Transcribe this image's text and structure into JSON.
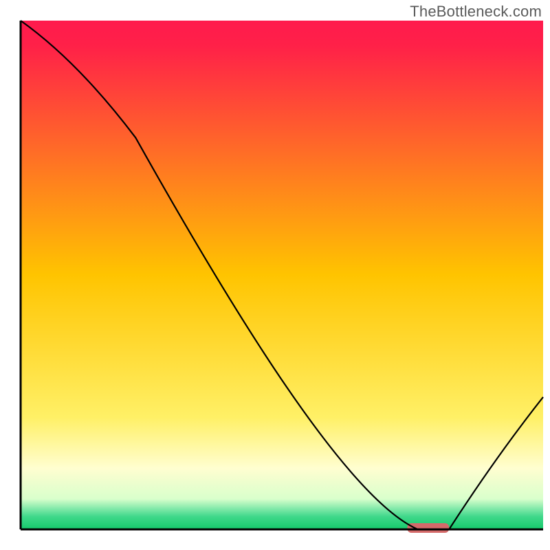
{
  "watermark": "TheBottleneck.com",
  "chart_data": {
    "type": "line",
    "title": "",
    "xlabel": "",
    "ylabel": "",
    "xlim": [
      0,
      100
    ],
    "ylim": [
      0,
      100
    ],
    "x": [
      0,
      22,
      76,
      82,
      100
    ],
    "values": [
      100,
      77,
      0,
      0,
      26
    ],
    "marker": {
      "x_start": 74,
      "x_end": 82,
      "y": 0
    },
    "gradient_stops": [
      {
        "offset": 0.0,
        "color": "#ff1a4d"
      },
      {
        "offset": 0.05,
        "color": "#ff2148"
      },
      {
        "offset": 0.5,
        "color": "#ffc400"
      },
      {
        "offset": 0.78,
        "color": "#fff066"
      },
      {
        "offset": 0.88,
        "color": "#fffed0"
      },
      {
        "offset": 0.94,
        "color": "#d9ffcc"
      },
      {
        "offset": 0.96,
        "color": "#7fe8a8"
      },
      {
        "offset": 0.975,
        "color": "#3fd88a"
      },
      {
        "offset": 1.0,
        "color": "#15c96b"
      }
    ],
    "marker_color": "#d46a6a",
    "line_color": "#000000",
    "axis_color": "#000000"
  }
}
